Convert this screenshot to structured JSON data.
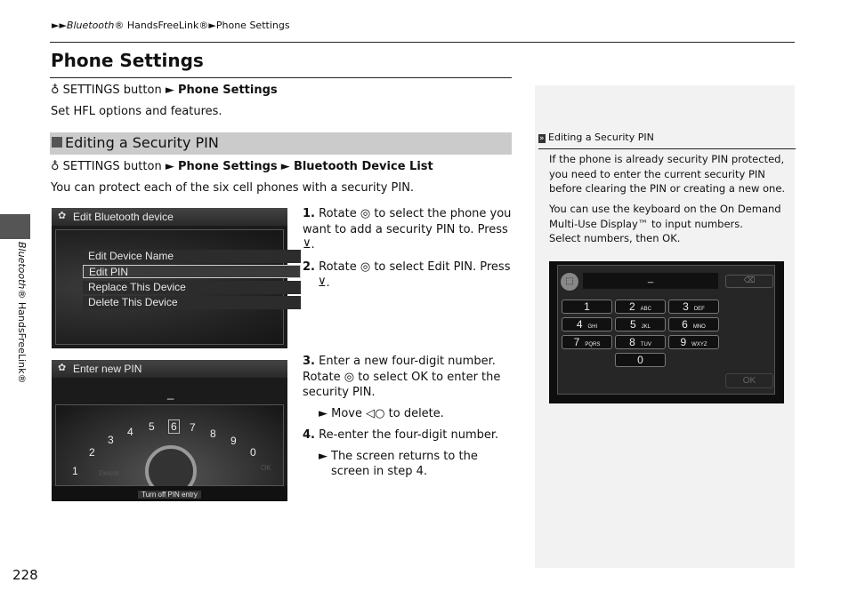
{
  "breadcrumb": {
    "arrows": "►►",
    "part1": "Bluetooth",
    "part1_suffix": "® HandsFreeLink®",
    "arrow2": "►",
    "part2": "Phone Settings"
  },
  "page": {
    "title": "Phone Settings",
    "page_number": "228",
    "side_tab": "Bluetooth",
    "side_tab_suffix": "® HandsFreeLink®"
  },
  "intro": {
    "nav_icon": "voice-command-icon",
    "nav_start": "SETTINGS button",
    "nav_arrow": "►",
    "nav_end": "Phone Settings",
    "description": "Set HFL options and features."
  },
  "section": {
    "title": "Editing a Security PIN",
    "nav_start": "SETTINGS button",
    "nav_mid": "Phone Settings",
    "nav_end": "Bluetooth Device List",
    "description": "You can protect each of the six cell phones with a security PIN."
  },
  "steps": [
    {
      "num": "1.",
      "text_a": "Rotate",
      "text_b": "to select the phone you want to add a security PIN to. Press",
      "text_c": "."
    },
    {
      "num": "2.",
      "text_a": "Rotate",
      "text_b": "to select",
      "bold": "Edit PIN.",
      "text_c": "Press",
      "text_d": "."
    },
    {
      "num": "3.",
      "text_a": "Enter a new four-digit number. Rotate",
      "text_b": "to select",
      "bold": "OK",
      "text_c": "to enter the security PIN.",
      "sub_a": "Move",
      "sub_b": "to delete."
    },
    {
      "num": "4.",
      "text_a": "Re-enter the four-digit number.",
      "sub_a": "The screen returns to the screen in step 4."
    }
  ],
  "screen1": {
    "title": "Edit Bluetooth device",
    "items": [
      "Edit Device Name",
      "Edit PIN",
      "Replace This Device",
      "Delete This Device"
    ],
    "selected": "Edit PIN"
  },
  "screen2": {
    "title": "Enter new PIN",
    "cursor": "_",
    "digits": [
      "1",
      "2",
      "3",
      "4",
      "5",
      "6",
      "7",
      "8",
      "9",
      "0"
    ],
    "selected": "6",
    "delete": "Delete",
    "ok": "OK",
    "bottom": "Turn off PIN entry"
  },
  "sidebar": {
    "heading_icon": "»",
    "heading": "Editing a Security PIN",
    "para1": "If the phone is already security PIN protected, you need to enter the current security PIN before clearing the PIN or creating a new one.",
    "para2a": "You can use the keyboard on the On Demand Multi-Use Display™ to input numbers.",
    "para2b": "Select numbers, then",
    "para2_bold": "OK",
    "para2_end": ".",
    "keypad": {
      "cursor": "_",
      "keys": [
        {
          "d": "1",
          "l": ""
        },
        {
          "d": "2",
          "l": "ABC"
        },
        {
          "d": "3",
          "l": "DEF"
        },
        {
          "d": "4",
          "l": "GHI"
        },
        {
          "d": "5",
          "l": "JKL"
        },
        {
          "d": "6",
          "l": "MNO"
        },
        {
          "d": "7",
          "l": "PQRS"
        },
        {
          "d": "8",
          "l": "TUV"
        },
        {
          "d": "9",
          "l": "WXYZ"
        },
        {
          "d": "0",
          "l": ""
        }
      ],
      "ok": "OK",
      "backspace": "⌫"
    }
  }
}
